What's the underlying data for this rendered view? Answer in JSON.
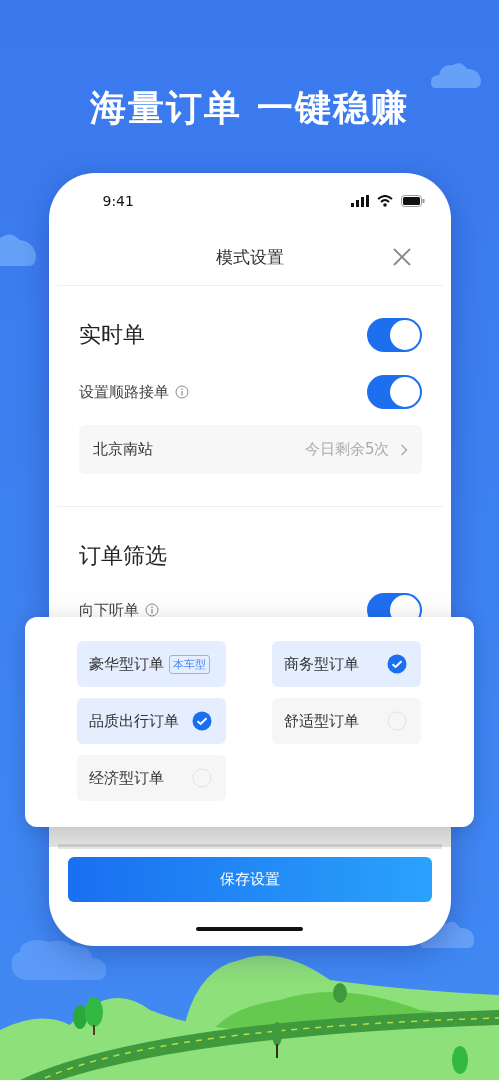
{
  "headline": "海量订单 一键稳赚",
  "status_bar": {
    "time": "9:41"
  },
  "sheet": {
    "title": "模式设置"
  },
  "realtime": {
    "title": "实时单",
    "on": true,
    "route": {
      "label": "设置顺路接单",
      "on": true
    },
    "station": {
      "name": "北京南站",
      "remaining": "今日剩余5次"
    }
  },
  "filter": {
    "title": "订单筛选",
    "listen_down": {
      "label": "向下听单",
      "on": true
    }
  },
  "order_types": [
    {
      "kind": "current",
      "label": "豪华型订单",
      "badge": "本车型",
      "selected": true
    },
    {
      "kind": "option",
      "label": "商务型订单",
      "selected": true
    },
    {
      "kind": "option",
      "label": "品质出行订单",
      "selected": true
    },
    {
      "kind": "option",
      "label": "舒适型订单",
      "selected": false
    },
    {
      "kind": "option",
      "label": "经济型订单",
      "selected": false
    }
  ],
  "save_button": "保存设置"
}
